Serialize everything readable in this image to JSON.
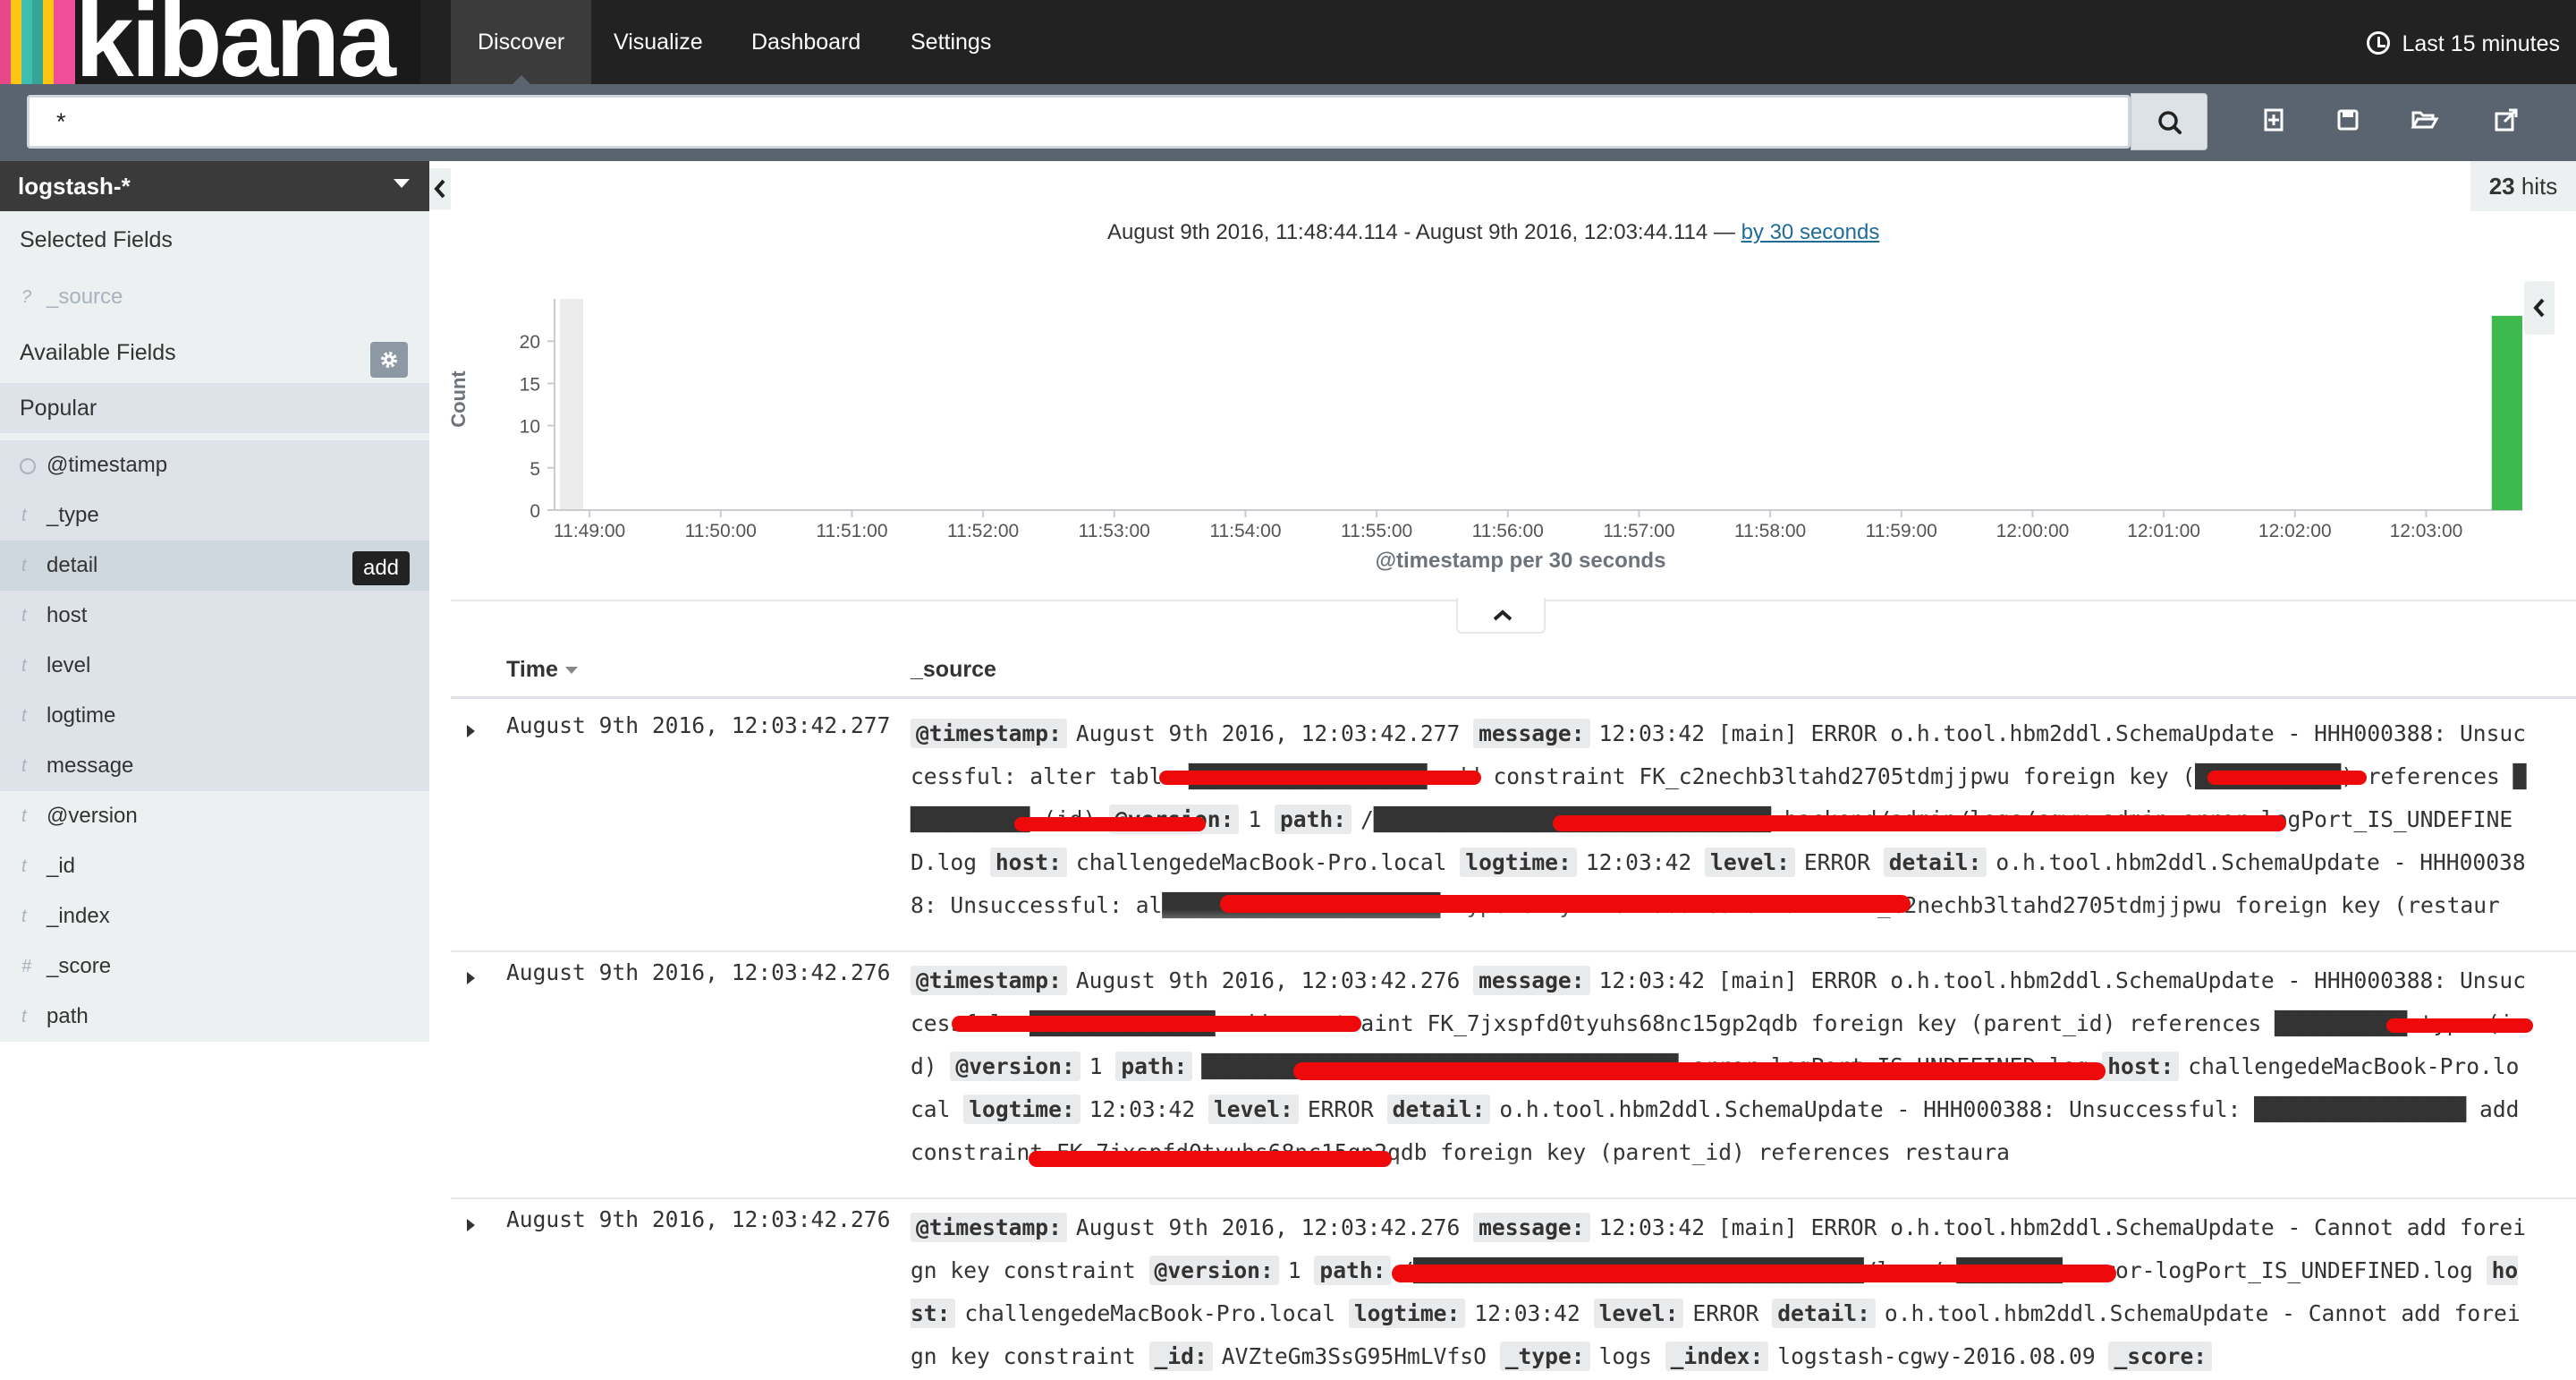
{
  "app": {
    "name": "kibana",
    "brand_colors": [
      "#e8478b",
      "#3ebeb0",
      "#fec514",
      "#37a595",
      "#f04e98"
    ]
  },
  "nav": {
    "items": [
      {
        "label": "Discover",
        "active": true
      },
      {
        "label": "Visualize",
        "active": false
      },
      {
        "label": "Dashboard",
        "active": false
      },
      {
        "label": "Settings",
        "active": false
      }
    ],
    "time_range": "Last 15 minutes"
  },
  "search": {
    "query": "*"
  },
  "toolbar": {
    "icons": [
      "new-search-icon",
      "save-search-icon",
      "open-search-icon",
      "share-search-icon"
    ]
  },
  "sidebar": {
    "index_pattern": "logstash-*",
    "selected_heading": "Selected Fields",
    "selected_fields": [
      {
        "type": "?",
        "name": "_source"
      }
    ],
    "available_heading": "Available Fields",
    "popular_heading": "Popular",
    "popular_fields": [
      {
        "type": "clock",
        "name": "@timestamp"
      },
      {
        "type": "t",
        "name": "_type"
      },
      {
        "type": "t",
        "name": "detail"
      },
      {
        "type": "t",
        "name": "host"
      },
      {
        "type": "t",
        "name": "level"
      },
      {
        "type": "t",
        "name": "logtime"
      },
      {
        "type": "t",
        "name": "message"
      }
    ],
    "other_fields": [
      {
        "type": "t",
        "name": "@version"
      },
      {
        "type": "t",
        "name": "_id"
      },
      {
        "type": "t",
        "name": "_index"
      },
      {
        "type": "#",
        "name": "_score"
      },
      {
        "type": "t",
        "name": "path"
      }
    ],
    "add_label": "add"
  },
  "results": {
    "hits": "23",
    "hits_label": " hits",
    "range_text": "August 9th 2016, 11:48:44.114 - August 9th 2016, 12:03:44.114 — ",
    "interval_link": "by 30 seconds"
  },
  "chart_data": {
    "type": "bar",
    "ylabel": "Count",
    "xlabel": "@timestamp per 30 seconds",
    "ylim": [
      0,
      25
    ],
    "yticks": [
      0,
      5,
      10,
      15,
      20
    ],
    "x_ticks": [
      "11:49:00",
      "11:50:00",
      "11:51:00",
      "11:52:00",
      "11:53:00",
      "11:54:00",
      "11:55:00",
      "11:56:00",
      "11:57:00",
      "11:58:00",
      "11:59:00",
      "12:00:00",
      "12:01:00",
      "12:02:00",
      "12:03:00"
    ],
    "bars": [
      {
        "x": "12:03:30",
        "value": 23
      }
    ],
    "bar_color": "#3db94e",
    "grid": false
  },
  "table": {
    "col_time": "Time",
    "col_source": "_source",
    "rows": [
      {
        "time": "August 9th 2016, 12:03:42.277",
        "fields": [
          {
            "k": "@timestamp:",
            "v": "August 9th 2016, 12:03:42.277"
          },
          {
            "k": "message:",
            "v": "12:03:42 [main] ERROR o.h.tool.hbm2ddl.SchemaUpdate - HHH000388: Unsuccessful: alter table ██████████████████ add constraint FK_c2nechb3ltahd2705tdmjjpwu foreign key (███████████) references ██████████ (id)"
          },
          {
            "k": "@version:",
            "v": "1"
          },
          {
            "k": "path:",
            "v": "/██████████████████████████████-backend/admin/logs/cgwy-admin-error-logPort_IS_UNDEFINED.log"
          },
          {
            "k": "host:",
            "v": "challengedeMacBook-Pro.local"
          },
          {
            "k": "logtime:",
            "v": "12:03:42"
          },
          {
            "k": "level:",
            "v": "ERROR"
          },
          {
            "k": "detail:",
            "v": "o.h.tool.hbm2ddl.SchemaUpdate - HHH000388: Unsuccessful: al█████████████████████ type city xref add constraint FK_c2nechb3ltahd2705tdmjjpwu foreign key (restaur"
          }
        ]
      },
      {
        "time": "August 9th 2016, 12:03:42.276",
        "fields": [
          {
            "k": "@timestamp:",
            "v": "August 9th 2016, 12:03:42.276"
          },
          {
            "k": "message:",
            "v": "12:03:42 [main] ERROR o.h.tool.hbm2ddl.SchemaUpdate - HHH000388: Unsuccessful: ██████████████ add constraint FK_7jxspfd0tyuhs68nc15gp2qdb foreign key (parent_id) references ██████████ type (id)"
          },
          {
            "k": "@version:",
            "v": "1"
          },
          {
            "k": "path:",
            "v": "████████████████████████████████████-error-logPort_IS_UNDEFINED.log"
          },
          {
            "k": "host:",
            "v": "challengedeMacBook-Pro.local"
          },
          {
            "k": "logtime:",
            "v": "12:03:42"
          },
          {
            "k": "level:",
            "v": "ERROR"
          },
          {
            "k": "detail:",
            "v": "o.h.tool.hbm2ddl.SchemaUpdate - HHH000388: Unsuccessful: ████████████████ add constraint FK_7jxspfd0tyuhs68nc15gp2qdb foreign key (parent_id) references restaura"
          }
        ]
      },
      {
        "time": "August 9th 2016, 12:03:42.276",
        "fields": [
          {
            "k": "@timestamp:",
            "v": "August 9th 2016, 12:03:42.276"
          },
          {
            "k": "message:",
            "v": "12:03:42 [main] ERROR o.h.tool.hbm2ddl.SchemaUpdate - Cannot add foreign key constraint"
          },
          {
            "k": "@version:",
            "v": "1"
          },
          {
            "k": "path:",
            "v": "/██████████████████████████████████/logs/c████████-error-logPort_IS_UNDEFINED.log"
          },
          {
            "k": "host:",
            "v": "challengedeMacBook-Pro.local"
          },
          {
            "k": "logtime:",
            "v": "12:03:42"
          },
          {
            "k": "level:",
            "v": "ERROR"
          },
          {
            "k": "detail:",
            "v": "o.h.tool.hbm2ddl.SchemaUpdate - Cannot add foreign key constraint"
          },
          {
            "k": "_id:",
            "v": "AVZteGm3SsG95HmLVfsO"
          },
          {
            "k": "_type:",
            "v": "logs"
          },
          {
            "k": "_index:",
            "v": "logstash-cgwy-2016.08.09"
          },
          {
            "k": "_score:",
            "v": ""
          }
        ]
      }
    ]
  }
}
